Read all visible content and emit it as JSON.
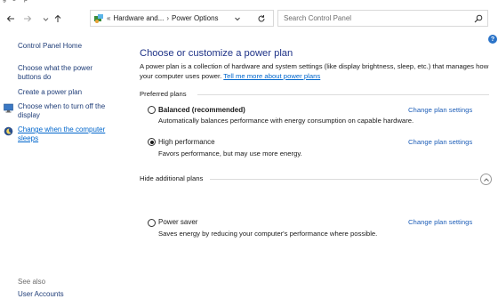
{
  "menu": {
    "items": [
      "g",
      "e",
      "p"
    ]
  },
  "address": {
    "crumb_overflow": "«",
    "crumb_1": "Hardware and...",
    "separator": "›",
    "crumb_2": "Power Options"
  },
  "search": {
    "placeholder": "Search Control Panel"
  },
  "left_pane": {
    "home": "Control Panel Home",
    "links": [
      "Choose what the power buttons do",
      "Create a power plan",
      "Choose when to turn off the display",
      "Change when the computer sleeps"
    ],
    "see_also": "See also",
    "user_accounts": "User Accounts"
  },
  "main": {
    "title": "Choose or customize a power plan",
    "description": "A power plan is a collection of hardware and system settings (like display brightness, sleep, etc.) that manages how your computer uses power.",
    "learn_link": "Tell me more about power plans",
    "preferred_label": "Preferred plans",
    "hide_label": "Hide additional plans",
    "change_label": "Change plan settings",
    "plans": [
      {
        "name": "Balanced (recommended)",
        "description": "Automatically balances performance with energy consumption on capable hardware.",
        "selected": false
      },
      {
        "name": "High performance",
        "description": "Favors performance, but may use more energy.",
        "selected": true
      },
      {
        "name": "Power saver",
        "description": "Saves energy by reducing your computer's performance where possible.",
        "selected": false
      }
    ]
  },
  "colors": {
    "heading": "#1e3287",
    "link": "#1f5fb8",
    "help": "#2a73c8"
  }
}
